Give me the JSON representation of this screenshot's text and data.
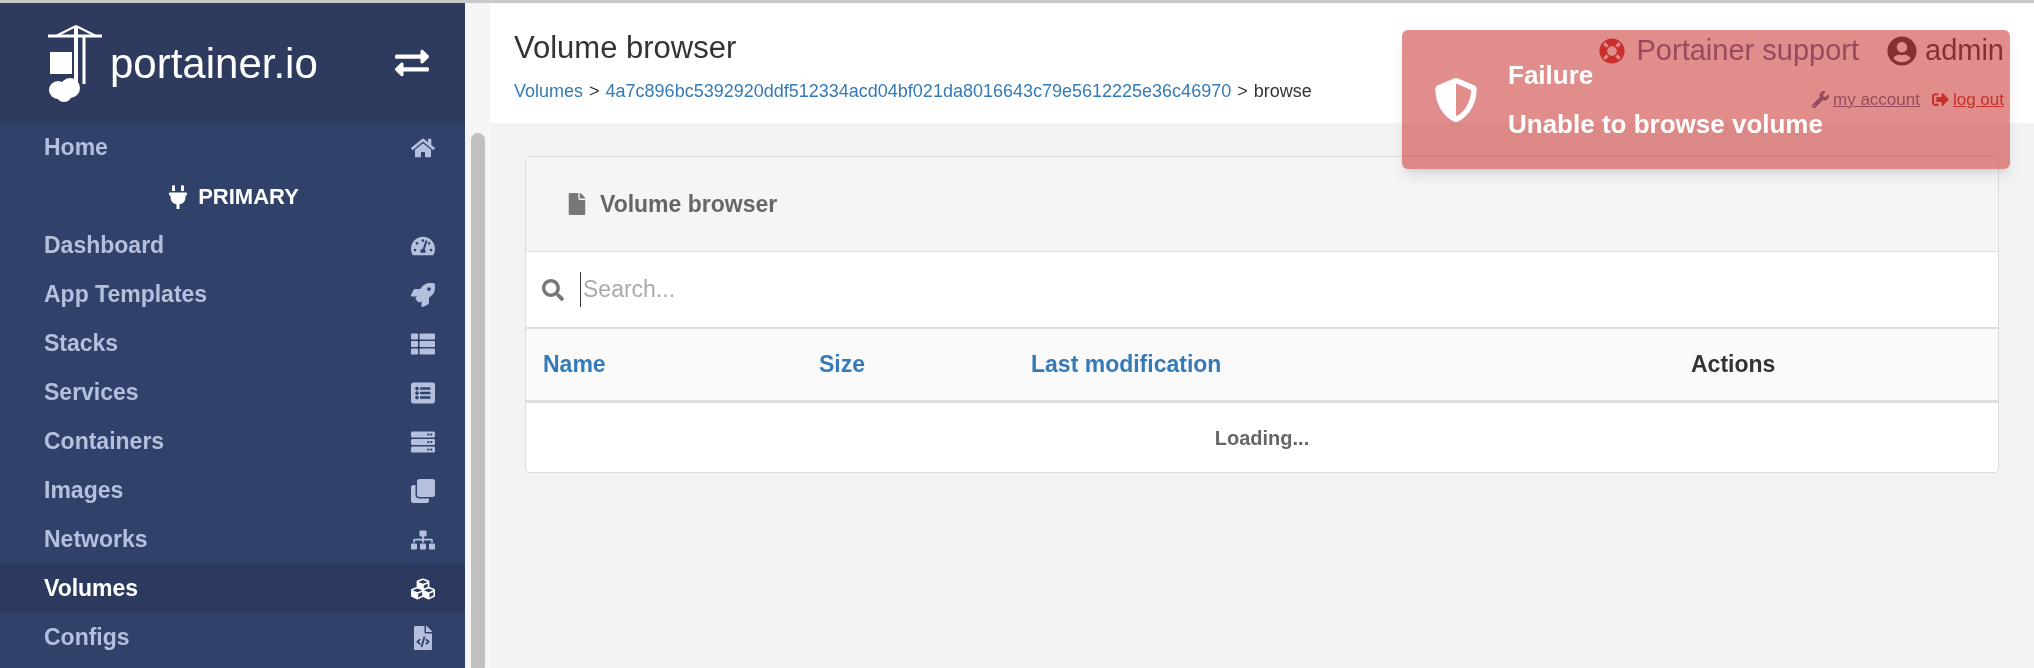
{
  "sidebar": {
    "logo": "portainer.io",
    "items": [
      {
        "label": "Home",
        "kind": "link",
        "selected": false
      },
      {
        "label": "PRIMARY",
        "kind": "heading"
      },
      {
        "label": "Dashboard",
        "kind": "link",
        "selected": false
      },
      {
        "label": "App Templates",
        "kind": "link",
        "selected": false
      },
      {
        "label": "Stacks",
        "kind": "link",
        "selected": false
      },
      {
        "label": "Services",
        "kind": "link",
        "selected": false
      },
      {
        "label": "Containers",
        "kind": "link",
        "selected": false
      },
      {
        "label": "Images",
        "kind": "link",
        "selected": false
      },
      {
        "label": "Networks",
        "kind": "link",
        "selected": false
      },
      {
        "label": "Volumes",
        "kind": "link",
        "selected": true
      },
      {
        "label": "Configs",
        "kind": "link",
        "selected": false
      }
    ]
  },
  "header": {
    "title": "Volume browser",
    "breadcrumb": [
      "Volumes",
      "4a7c896bc5392920ddf512334acd04bf021da8016643c79e5612225e36c46970",
      "browse"
    ],
    "breadcrumb_separator": ">",
    "support": "Portainer support",
    "user": "admin",
    "my_account": "my account",
    "log_out": "log out"
  },
  "panel": {
    "title": "Volume browser",
    "search": {
      "placeholder": "Search..."
    },
    "columns": [
      {
        "label": "Name",
        "sortable": true
      },
      {
        "label": "Size",
        "sortable": true
      },
      {
        "label": "Last modification",
        "sortable": true
      },
      {
        "label": "Actions",
        "sortable": false
      }
    ],
    "status": "Loading..."
  },
  "toast": {
    "title": "Failure",
    "message": "Unable to browse volume"
  }
}
